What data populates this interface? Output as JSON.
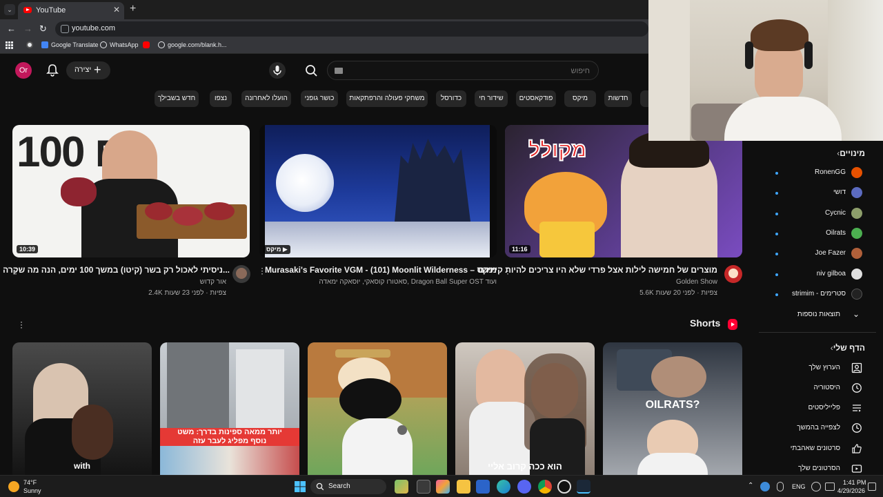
{
  "browser": {
    "tab_title": "YouTube",
    "url": "youtube.com",
    "bookmarks": [
      "Google Translate",
      "WhatsApp",
      "google.com/blank.h..."
    ]
  },
  "header": {
    "avatar_initials": "Or",
    "create_label": "יצירה",
    "search_placeholder": "חיפוש"
  },
  "chips": [
    "ה",
    "חדשות",
    "מיקס",
    "פודקאסטים",
    "שידור חי",
    "כדורסל",
    "משחקי פעולה והרפתקאות",
    "כושר גופני",
    "הועלו לאחרונה",
    "נצפו",
    "חדש בשבילך"
  ],
  "sidebar": {
    "subs_heading": "מינויים",
    "subscriptions": [
      {
        "name": "RonenGG",
        "color": "#e65100"
      },
      {
        "name": "דושי",
        "color": "#5c6bc0"
      },
      {
        "name": "Cycnic",
        "color": "#8d9e6b"
      },
      {
        "name": "Oilrats",
        "color": "#4caf50"
      },
      {
        "name": "Joe Fazer",
        "color": "#b0603a"
      },
      {
        "name": "niv gilboa",
        "color": "#e0e0e0"
      },
      {
        "name": "strimim - סטרימים",
        "color": "#222222"
      }
    ],
    "show_more": "תוצאות נוספות",
    "you_heading": "הדף שלי",
    "you_items": [
      "הערוץ שלך",
      "היסטוריה",
      "פלייליסטים",
      "לצפייה בהמשך",
      "סרטונים שאהבתי",
      "הסרטונים שלך"
    ]
  },
  "videos": [
    {
      "title": "ניסיתי לאכול רק בשר (קיטו) במשך 100 ימים, הנה מה שקרה...",
      "channel": "אור קדוש",
      "views_time": "2.4K צפיות · לפני 23 שעות",
      "duration": "10:39",
      "thumb_text": "100 יום"
    },
    {
      "title": "Murasaki's Favorite VGM - (101) Moonlit Wilderness – מיקס",
      "channel": "סאטורו קוסאקי, יוסאקה ימאדה, Dragon Ball Super OST ועוד",
      "views_time": "",
      "duration": "מיקס",
      "thumb_text": ""
    },
    {
      "title": "מוצרים של חמישה לילות אצל פרדי שלא היו צריכים להיות קיימים",
      "channel": "Golden Show",
      "views_time": "5.6K צפיות · לפני 20 שעות",
      "duration": "11:16",
      "thumb_text": "מקולל"
    }
  ],
  "shorts": {
    "heading": "Shorts",
    "items": [
      {
        "caption": "with",
        "c1": "#3a3a3a",
        "c2": "#151515"
      },
      {
        "caption": "יותר ממאה ספינות בדרך: משט נוסף מפליג לעבר עזה",
        "c1": "#8a8a8a",
        "c2": "#d0d4d8"
      },
      {
        "caption": "",
        "c1": "#c98b4a",
        "c2": "#7cae5c"
      },
      {
        "caption": "הוא ככה קרוב אליי",
        "c1": "#c2c0bc",
        "c2": "#6b5a4e"
      },
      {
        "caption": "OILRATS?",
        "c1": "#3b4450",
        "c2": "#9aa0a8"
      }
    ]
  },
  "taskbar": {
    "temp": "74°F",
    "weather": "Sunny",
    "search_label": "Search",
    "lang": "ENG",
    "time": "1:41 PM",
    "date": "4/29/2026"
  }
}
